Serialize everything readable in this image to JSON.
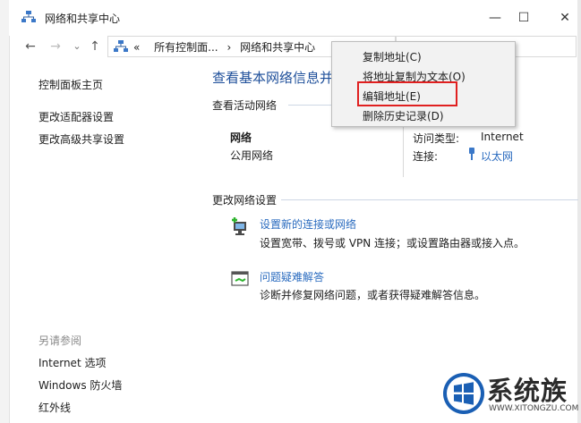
{
  "window": {
    "title": "网络和共享中心",
    "minimize": "—",
    "maximize": "☐",
    "close": "✕"
  },
  "nav": {
    "back": "←",
    "forward": "→",
    "recent": "⌄",
    "up": "↑",
    "breadcrumb_sep": "«",
    "crumb1": "所有控制面...",
    "crumb_arrow": "›",
    "crumb2": "网络和共享中心"
  },
  "left_pane": {
    "home": "控制面板主页",
    "adapter": "更改适配器设置",
    "advanced": "更改高级共享设置",
    "see_also": "另请参阅",
    "internet_options": "Internet 选项",
    "firewall": "Windows 防火墙",
    "infrared": "红外线"
  },
  "main": {
    "heading": "查看基本网络信息并",
    "active_networks": "查看活动网络",
    "network_name": "网络",
    "network_type": "公用网络",
    "access_type_label": "访问类型:",
    "access_type_value": "Internet",
    "connections_label": "连接:",
    "connection_value": "以太网",
    "change_settings": "更改网络设置",
    "setup_link": "设置新的连接或网络",
    "setup_desc": "设置宽带、拨号或 VPN 连接；或设置路由器或接入点。",
    "troubleshoot_link": "问题疑难解答",
    "troubleshoot_desc": "诊断并修复网络问题，或者获得疑难解答信息。"
  },
  "context_menu": {
    "items": [
      "复制地址(C)",
      "将地址复制为文本(O)",
      "编辑地址(E)",
      "删除历史记录(D)"
    ],
    "highlighted_index": 2
  },
  "watermark": {
    "text": "系统族",
    "sub": "WWW.XITONGZU.COM"
  },
  "colors": {
    "heading": "#1e4f9a",
    "link": "#2a6bbf",
    "highlight_border": "#e02020"
  }
}
